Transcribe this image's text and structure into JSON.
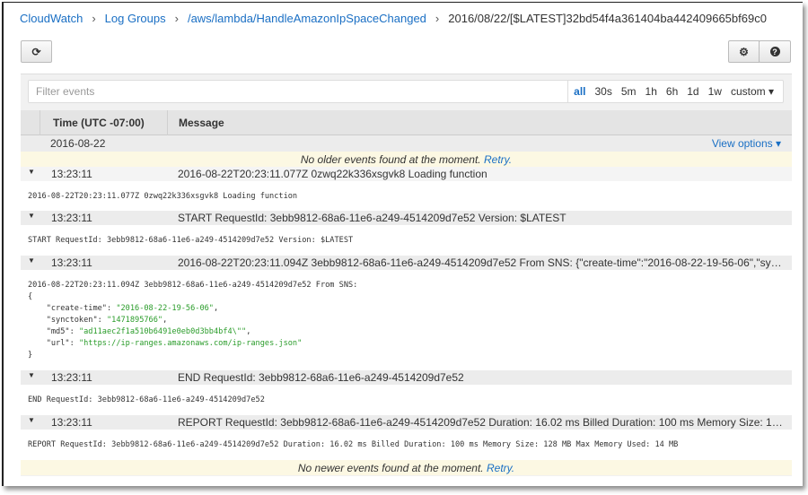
{
  "breadcrumb": [
    "CloudWatch",
    "Log Groups",
    "/aws/lambda/HandleAmazonIpSpaceChanged",
    "2016/08/22/[$LATEST]32bd54f4a361404ba442409665bf69c0"
  ],
  "toolbar": {
    "refresh_icon": "⟳",
    "settings_icon": "⚙",
    "help_icon": "?"
  },
  "filter": {
    "placeholder": "Filter events",
    "ranges": [
      "all",
      "30s",
      "5m",
      "1h",
      "6h",
      "1d",
      "1w",
      "custom ▾"
    ],
    "active": "all"
  },
  "table": {
    "col_time": "Time (UTC -07:00)",
    "col_message": "Message",
    "date": "2016-08-22",
    "view_options": "View options ▾"
  },
  "notices": {
    "older": "No older events found at the moment.",
    "newer": "No newer events found at the moment.",
    "retry": "Retry."
  },
  "events": [
    {
      "time": "13:23:11",
      "message": "2016-08-22T20:23:11.077Z 0zwq22k336xsgvk8 Loading function",
      "detail": "2016-08-22T20:23:11.077Z 0zwq22k336xsgvk8 Loading function"
    },
    {
      "time": "13:23:11",
      "message": "START RequestId: 3ebb9812-68a6-11e6-a249-4514209d7e52 Version: $LATEST",
      "detail": "START RequestId: 3ebb9812-68a6-11e6-a249-4514209d7e52 Version: $LATEST"
    },
    {
      "time": "13:23:11",
      "message": "2016-08-22T20:23:11.094Z 3ebb9812-68a6-11e6-a249-4514209d7e52 From SNS: {\"create-time\":\"2016-08-22-19-56-06\",\"synctoken\":\"1471895766\",\"md5\":\"ad11aec2f1a510b6491e0eb0d3bb4bf4\\\"\",\"url\":\"https://ip-ranges.amazonaws.com/ip-ranges.json\"}",
      "detail": "2016-08-22T20:23:11.094Z 3ebb9812-68a6-11e6-a249-4514209d7e52 From SNS:",
      "json": [
        [
          "create-time",
          "\"2016-08-22-19-56-06\""
        ],
        [
          "synctoken",
          "\"1471895766\""
        ],
        [
          "md5",
          "\"ad11aec2f1a510b6491e0eb0d3bb4bf4\\\"\""
        ],
        [
          "url",
          "\"https://ip-ranges.amazonaws.com/ip-ranges.json\""
        ]
      ]
    },
    {
      "time": "13:23:11",
      "message": "END RequestId: 3ebb9812-68a6-11e6-a249-4514209d7e52",
      "detail": "END RequestId: 3ebb9812-68a6-11e6-a249-4514209d7e52"
    },
    {
      "time": "13:23:11",
      "message": "REPORT RequestId: 3ebb9812-68a6-11e6-a249-4514209d7e52 Duration: 16.02 ms Billed Duration: 100 ms Memory Size: 128 MB Max Memory Used: 14 MB",
      "detail": "REPORT RequestId: 3ebb9812-68a6-11e6-a249-4514209d7e52 Duration: 16.02 ms Billed Duration: 100 ms Memory Size: 128 MB Max Memory Used: 14 MB"
    }
  ]
}
